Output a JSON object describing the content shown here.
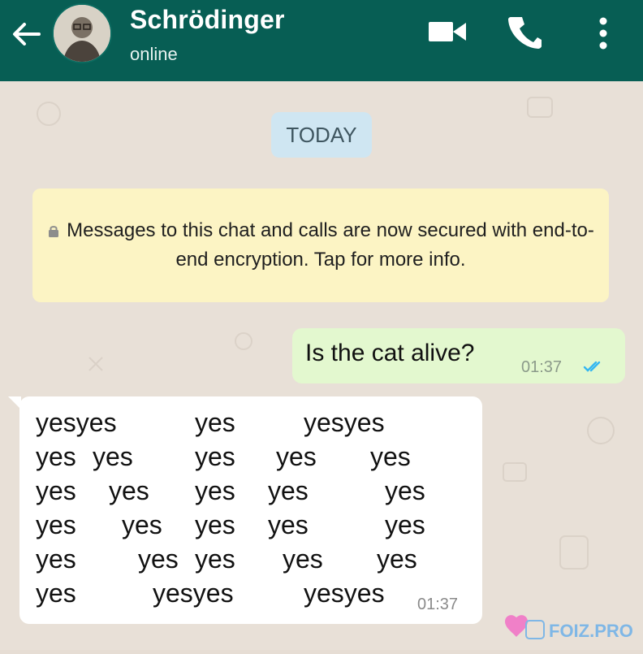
{
  "header": {
    "title": "Schrödinger",
    "status": "online",
    "back_icon": "arrow-left-icon",
    "video_icon": "video-camera-icon",
    "call_icon": "phone-icon",
    "menu_icon": "more-vert-icon"
  },
  "chat": {
    "date_label": "TODAY",
    "encryption_notice": "Messages to this chat and calls are now secured with end-to-end encryption. Tap for more info.",
    "outgoing": {
      "text": "Is the cat alive?",
      "time": "01:37",
      "status": "read"
    },
    "incoming": {
      "lines": [
        [
          "yesyes",
          "yes",
          "yesyes"
        ],
        [
          "yes",
          "yes",
          "yes",
          "yes",
          "yes"
        ],
        [
          "yes",
          "yes",
          "yes",
          "yes",
          "yes"
        ],
        [
          "yes",
          "yes",
          "yes",
          "yes",
          "yes"
        ],
        [
          "yes",
          "yes",
          "yes",
          "yes",
          "yes"
        ],
        [
          "yes",
          "yesyes",
          "yesyes"
        ]
      ],
      "time": "01:37"
    }
  },
  "watermark": "FOIZ.PRO",
  "colors": {
    "header": "#075e54",
    "wallpaper": "#e8e0d7",
    "outgoing": "#e3f8cf",
    "incoming": "#ffffff",
    "date_chip": "#cfe6f2",
    "notice": "#fcf4c4"
  }
}
